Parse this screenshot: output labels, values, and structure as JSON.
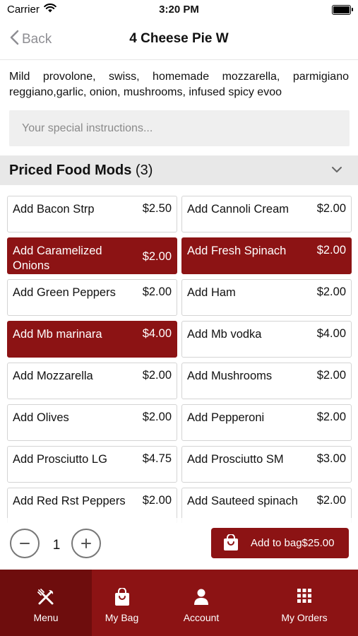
{
  "status": {
    "carrier": "Carrier",
    "time": "3:20 PM"
  },
  "nav": {
    "back_label": "Back",
    "title": "4 Cheese Pie W"
  },
  "description": "Mild provolone, swiss, homemade mozzarella, parmigiano reggiano,garlic, onion, mushrooms, infused spicy evoo",
  "instructions": {
    "placeholder": "Your special instructions...",
    "value": ""
  },
  "section": {
    "title": "Priced Food Mods",
    "count": "(3)",
    "expanded": true
  },
  "mods": [
    {
      "name": "Add Bacon Strp",
      "price": "$2.50",
      "selected": false
    },
    {
      "name": "Add Cannoli Cream",
      "price": "$2.00",
      "selected": false
    },
    {
      "name": "Add Caramelized Onions",
      "price": "$2.00",
      "selected": true
    },
    {
      "name": "Add Fresh Spinach",
      "price": "$2.00",
      "selected": true
    },
    {
      "name": "Add Green Peppers",
      "price": "$2.00",
      "selected": false
    },
    {
      "name": "Add Ham",
      "price": "$2.00",
      "selected": false
    },
    {
      "name": "Add Mb marinara",
      "price": "$4.00",
      "selected": true
    },
    {
      "name": "Add Mb vodka",
      "price": "$4.00",
      "selected": false
    },
    {
      "name": "Add Mozzarella",
      "price": "$2.00",
      "selected": false
    },
    {
      "name": "Add Mushrooms",
      "price": "$2.00",
      "selected": false
    },
    {
      "name": "Add Olives",
      "price": "$2.00",
      "selected": false
    },
    {
      "name": "Add Pepperoni",
      "price": "$2.00",
      "selected": false
    },
    {
      "name": "Add Prosciutto LG",
      "price": "$4.75",
      "selected": false
    },
    {
      "name": "Add Prosciutto SM",
      "price": "$3.00",
      "selected": false
    },
    {
      "name": "Add Red Rst Peppers",
      "price": "$2.00",
      "selected": false
    },
    {
      "name": "Add Sauteed spinach",
      "price": "$2.00",
      "selected": false
    }
  ],
  "quantity": "1",
  "add_to_bag": {
    "label": "Add to bag$25.00"
  },
  "tabs": [
    {
      "label": "Menu",
      "icon": "fork-knife-icon",
      "active": true
    },
    {
      "label": "My Bag",
      "icon": "shopping-bag-icon",
      "active": false
    },
    {
      "label": "Account",
      "icon": "person-icon",
      "active": false
    },
    {
      "label": "My Orders",
      "icon": "grid-icon",
      "active": false
    }
  ],
  "colors": {
    "accent": "#8c1314",
    "accent_dark": "#6e0d0d",
    "section_bg": "#e8e8e8"
  }
}
